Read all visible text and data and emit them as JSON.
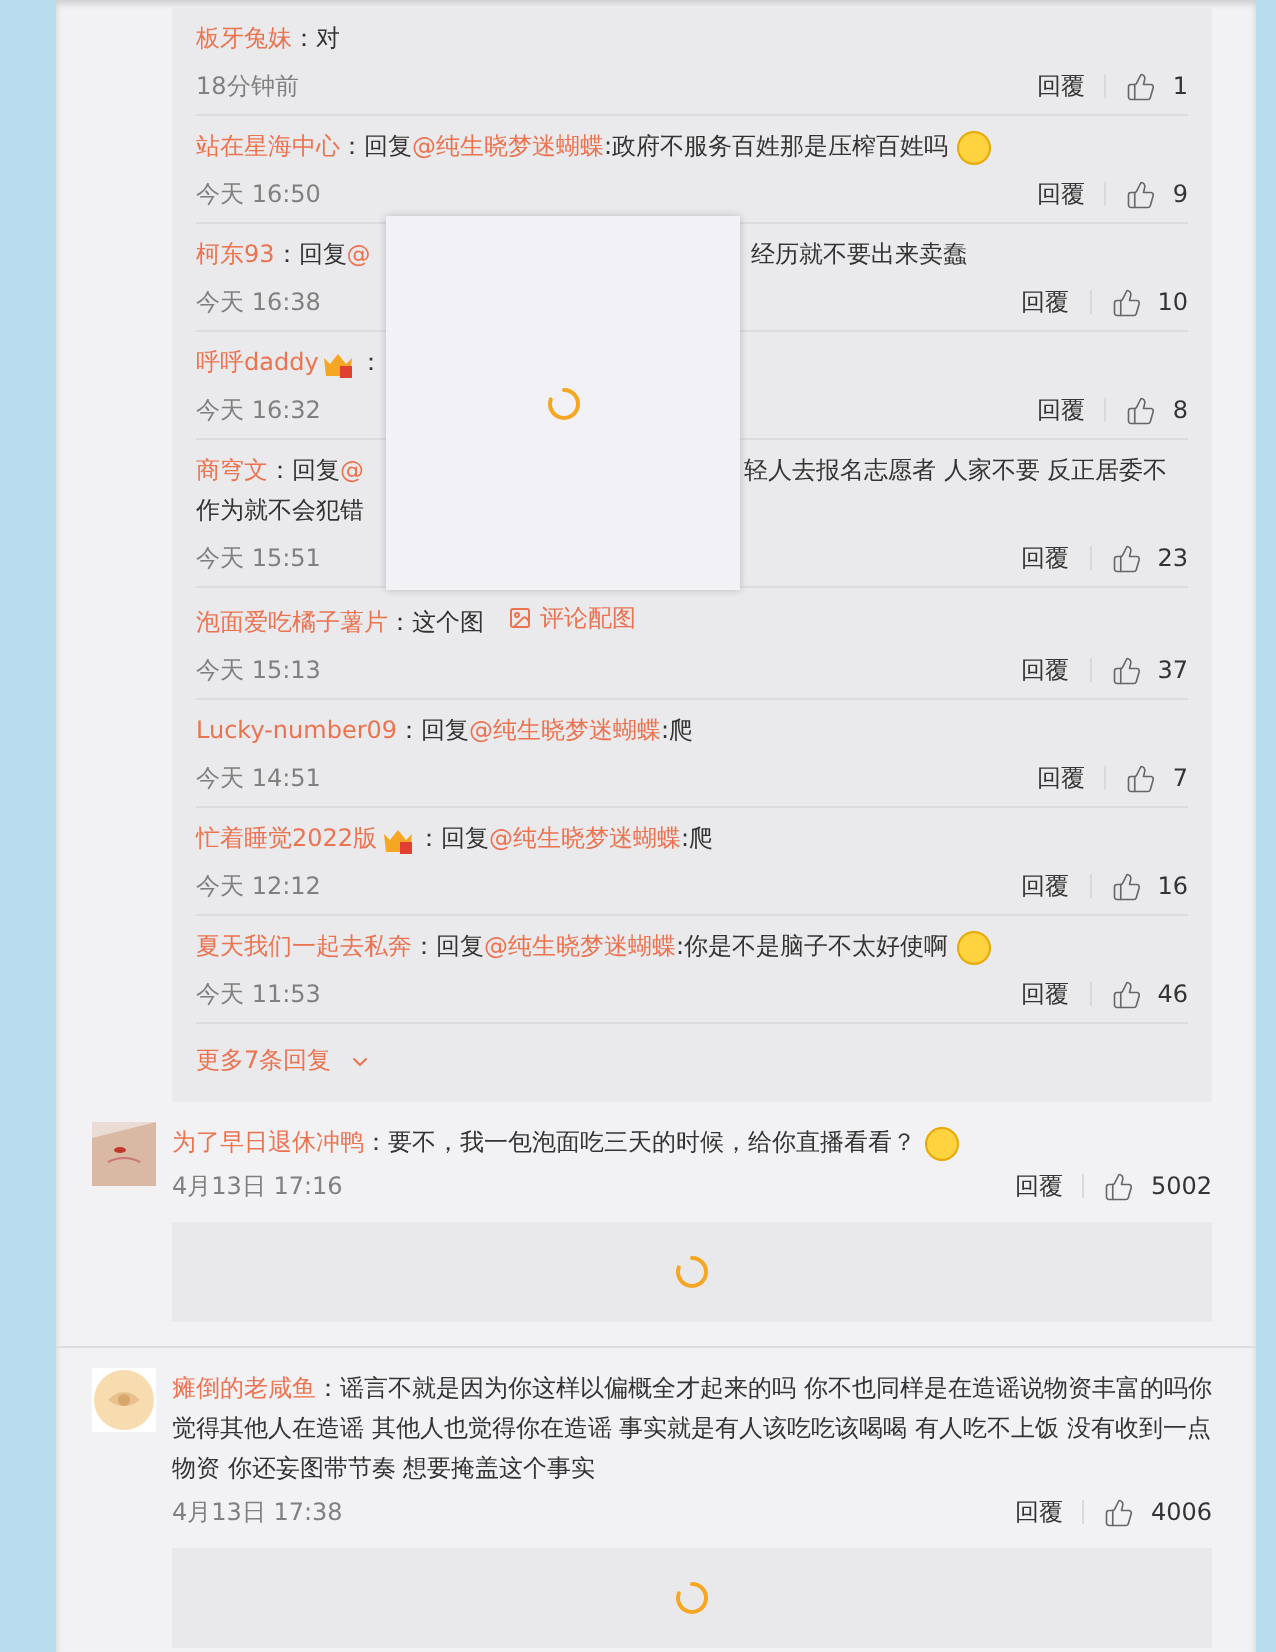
{
  "thread": {
    "replies": [
      {
        "user": "板牙兔妹",
        "badge": false,
        "body": [
          {
            "kind": "plain",
            "text": "：对"
          }
        ],
        "emoji": false,
        "time": "18分钟前",
        "reply_label": "回覆",
        "likes": "1"
      },
      {
        "user": "站在星海中心",
        "badge": false,
        "body": [
          {
            "kind": "plain",
            "text": "：回复"
          },
          {
            "kind": "mention",
            "text": "@纯生晓梦迷蝴蝶"
          },
          {
            "kind": "plain",
            "text": ":政府不服务百姓那是压榨百姓吗"
          }
        ],
        "emoji": true,
        "time": "今天 16:50",
        "reply_label": "回覆",
        "likes": "9"
      },
      {
        "user": "柯东93",
        "badge": false,
        "body": [
          {
            "kind": "plain",
            "text": "：回复"
          },
          {
            "kind": "mention",
            "text": "@"
          },
          {
            "kind": "covered"
          },
          {
            "kind": "plain",
            "text": "经历就不要出来卖蠢"
          }
        ],
        "emoji": false,
        "time": "今天 16:38",
        "reply_label": "回覆",
        "likes": "10"
      },
      {
        "user": "呼呼daddy",
        "badge": true,
        "body": [
          {
            "kind": "plain",
            "text": "："
          },
          {
            "kind": "covered"
          }
        ],
        "emoji": false,
        "time": "今天 16:32",
        "reply_label": "回覆",
        "likes": "8"
      },
      {
        "user": "商穹文",
        "badge": false,
        "body": [
          {
            "kind": "plain",
            "text": "：回复"
          },
          {
            "kind": "mention",
            "text": "@"
          },
          {
            "kind": "covered"
          },
          {
            "kind": "plain",
            "text": "轻人去报名志愿者 人家不要 反正居委不作为就不会犯错"
          }
        ],
        "emoji": false,
        "time": "今天 15:51",
        "reply_label": "回覆",
        "likes": "23"
      },
      {
        "user": "泡面爱吃橘子薯片",
        "badge": false,
        "body": [
          {
            "kind": "plain",
            "text": "：这个图"
          }
        ],
        "image_link": "评论配图",
        "emoji": false,
        "time": "今天 15:13",
        "reply_label": "回覆",
        "likes": "37"
      },
      {
        "user": "Lucky-number09",
        "badge": false,
        "body": [
          {
            "kind": "plain",
            "text": "：回复"
          },
          {
            "kind": "mention",
            "text": "@纯生晓梦迷蝴蝶"
          },
          {
            "kind": "plain",
            "text": ":爬"
          }
        ],
        "emoji": false,
        "time": "今天 14:51",
        "reply_label": "回覆",
        "likes": "7"
      },
      {
        "user": "忙着睡觉2022版",
        "badge": true,
        "body": [
          {
            "kind": "plain",
            "text": "：回复"
          },
          {
            "kind": "mention",
            "text": "@纯生晓梦迷蝴蝶"
          },
          {
            "kind": "plain",
            "text": ":爬"
          }
        ],
        "emoji": false,
        "time": "今天 12:12",
        "reply_label": "回覆",
        "likes": "16"
      },
      {
        "user": "夏天我们一起去私奔",
        "badge": false,
        "body": [
          {
            "kind": "plain",
            "text": "：回复"
          },
          {
            "kind": "mention",
            "text": "@纯生晓梦迷蝴蝶"
          },
          {
            "kind": "plain",
            "text": ":你是不是脑子不太好使啊"
          }
        ],
        "emoji": true,
        "time": "今天 11:53",
        "reply_label": "回覆",
        "likes": "46"
      }
    ],
    "more": "更多7条回复"
  },
  "comments": [
    {
      "user": "为了早日退休冲鸭",
      "body": [
        {
          "kind": "plain",
          "text": "：要不，我一包泡面吃三天的时候，给你直播看看？"
        }
      ],
      "emoji": true,
      "time": "4月13日 17:16",
      "reply_label": "回覆",
      "likes": "5002",
      "loading": true
    },
    {
      "user": "瘫倒的老咸鱼",
      "body": [
        {
          "kind": "plain",
          "text": "：谣言不就是因为你这样以偏概全才起来的吗 你不也同样是在造谣说物资丰富的吗你觉得其他人在造谣 其他人也觉得你在造谣 事实就是有人该吃吃该喝喝 有人吃不上饭 没有收到一点物资 你还妄图带节奏 想要掩盖这个事实"
        }
      ],
      "emoji": false,
      "time": "4月13日 17:38",
      "reply_label": "回覆",
      "likes": "4006",
      "loading": true
    }
  ],
  "popup": {
    "loading": true
  }
}
